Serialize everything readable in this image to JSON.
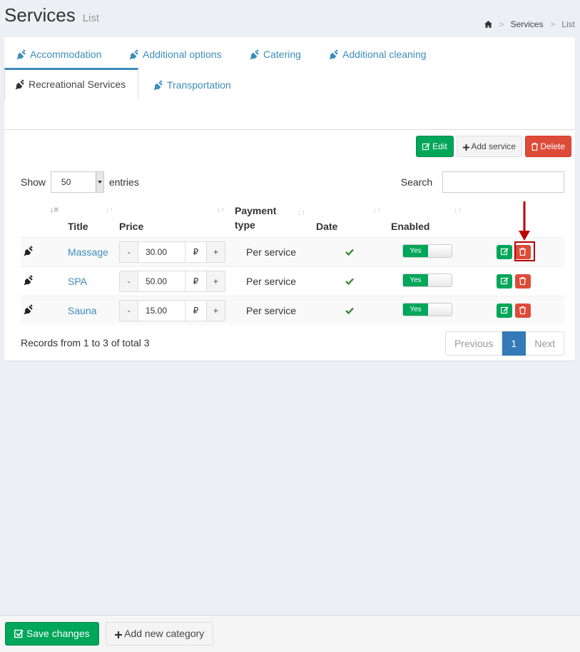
{
  "header": {
    "title": "Services",
    "subtitle": "List"
  },
  "breadcrumb": {
    "items": [
      "Services",
      "List"
    ],
    "separator": ">"
  },
  "tabs": [
    {
      "label": "Accommodation",
      "active": false
    },
    {
      "label": "Additional options",
      "active": false
    },
    {
      "label": "Catering",
      "active": false
    },
    {
      "label": "Additional cleaning",
      "active": false
    },
    {
      "label": "Recreational Services",
      "active": true
    },
    {
      "label": "Transportation",
      "active": false
    }
  ],
  "toolbar": {
    "edit_label": "Edit",
    "add_label": "Add service",
    "delete_label": "Delete"
  },
  "table_controls": {
    "show_label": "Show",
    "entries_value": "50",
    "entries_label": "entries",
    "search_label": "Search",
    "search_value": ""
  },
  "columns": {
    "title": "Title",
    "price": "Price",
    "payment_line1": "Payment",
    "payment_line2": "type",
    "date": "Date",
    "enabled": "Enabled"
  },
  "rows": [
    {
      "title": "Massage",
      "minus": "-",
      "price": "30.00",
      "currency": "₽",
      "plus": "+",
      "payment_type": "Per service",
      "enabled": "Yes"
    },
    {
      "title": "SPA",
      "minus": "-",
      "price": "50.00",
      "currency": "₽",
      "plus": "+",
      "payment_type": "Per service",
      "enabled": "Yes"
    },
    {
      "title": "Sauna",
      "minus": "-",
      "price": "15.00",
      "currency": "₽",
      "plus": "+",
      "payment_type": "Per service",
      "enabled": "Yes"
    }
  ],
  "records_text": "Records from 1 to 3 of total 3",
  "pagination": {
    "previous": "Previous",
    "current": "1",
    "next": "Next"
  },
  "footer": {
    "save_label": "Save changes",
    "add_category_label": "Add new category"
  },
  "colors": {
    "primary": "#3c8dbc",
    "success": "#00a65a",
    "danger": "#dd4b39",
    "highlight": "#b00000"
  },
  "icons": {
    "tab": "plug-icon",
    "home": "home-icon",
    "edit": "edit-icon",
    "delete": "trash-icon",
    "check": "check-icon"
  }
}
